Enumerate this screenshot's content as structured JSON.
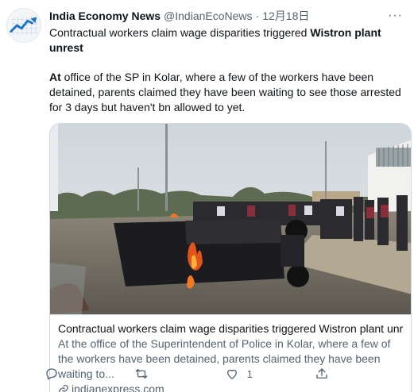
{
  "tweet": {
    "author_name": "India Economy News",
    "handle": "@IndianEcoNews",
    "separator": "·",
    "time": "12月18日",
    "more_label": "···",
    "text_line1_plain": "Contractual workers claim wage disparities triggered ",
    "text_line1_bold": "Wistron plant unrest",
    "text_para2_bold": "At",
    "text_para2_plain": " office of the SP in Kolar, where a few of the workers have been detained, parents claimed they have been waiting to see those arrested for 3 days but haven't bn allowed to yet."
  },
  "card": {
    "title": "Contractual workers claim wage disparities triggered Wistron plant unrest",
    "description": "At the office of the Superintendent of Police in Kolar, where a few of the workers have been detained, parents claimed they have been waiting to...",
    "domain": "indianexpress.com"
  },
  "actions": {
    "reply_count": "",
    "retweet_count": "",
    "like_count": "1",
    "share_count": ""
  },
  "icons": {
    "avatar": "rising-chart-logo",
    "reply": "reply-icon",
    "retweet": "retweet-icon",
    "like": "heart-icon",
    "share": "share-icon",
    "link": "link-icon"
  },
  "colors": {
    "text_primary": "#0f1419",
    "text_secondary": "#536471",
    "border": "#cfd9de",
    "logo_blue": "#1a73c9"
  }
}
